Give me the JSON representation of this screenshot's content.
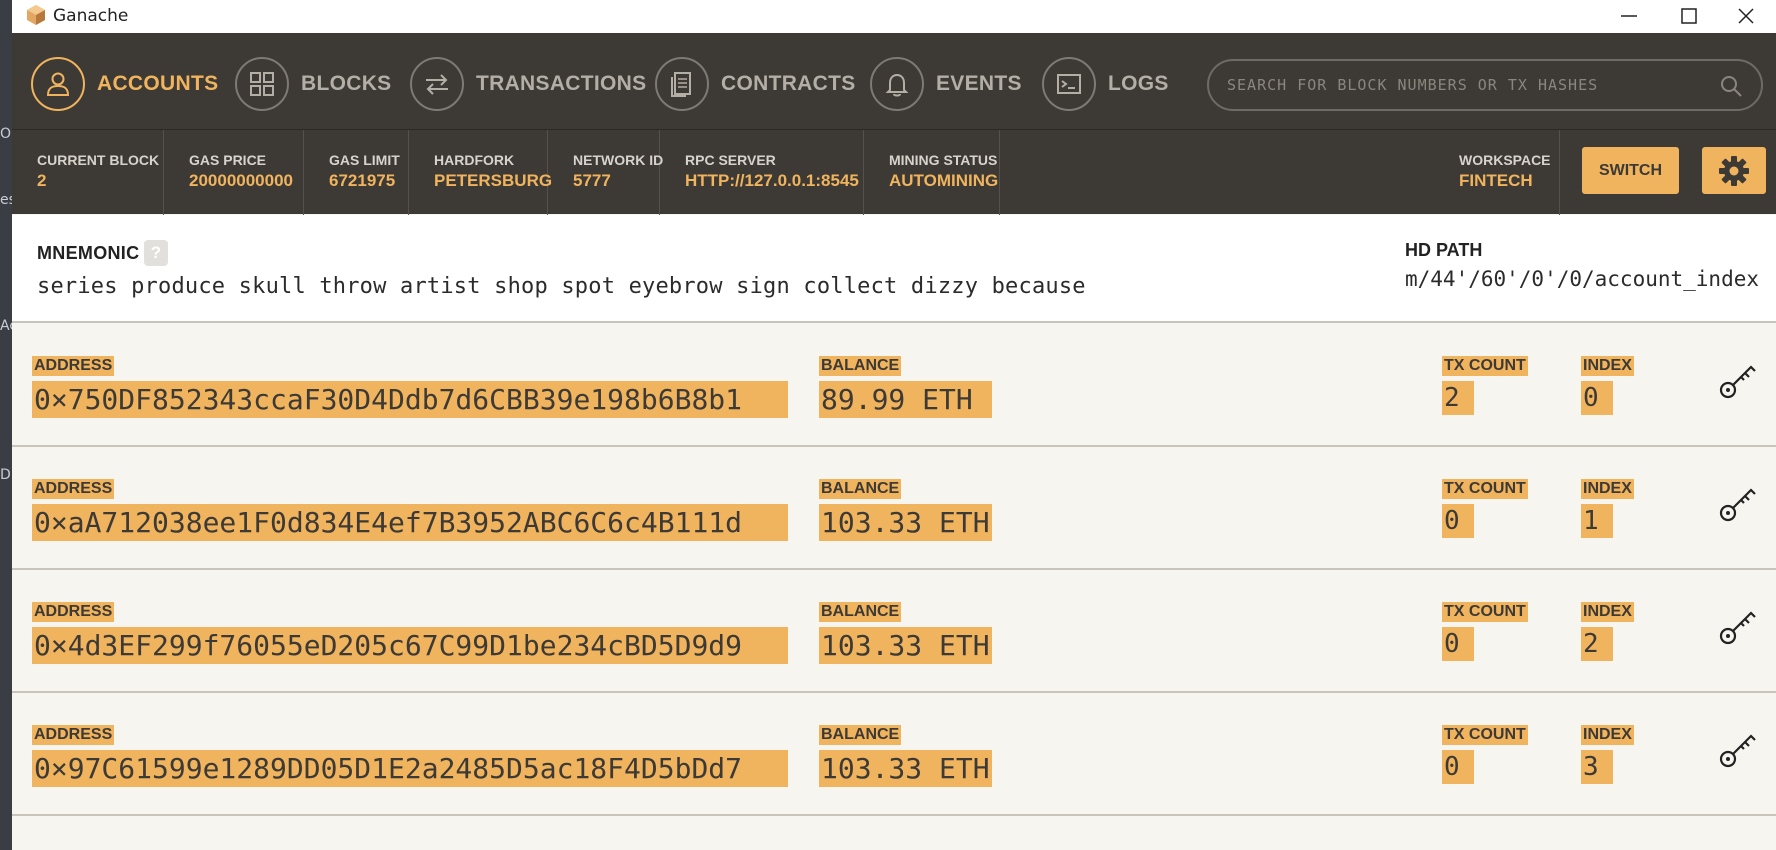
{
  "background": {
    "strip_text": [
      "O",
      "es",
      "Ac",
      "DB"
    ]
  },
  "window": {
    "title": "Ganache"
  },
  "nav": {
    "items": [
      {
        "label": "ACCOUNTS",
        "icon": "person-icon",
        "active": true
      },
      {
        "label": "BLOCKS",
        "icon": "grid-icon",
        "active": false
      },
      {
        "label": "TRANSACTIONS",
        "icon": "arrows-icon",
        "active": false
      },
      {
        "label": "CONTRACTS",
        "icon": "document-icon",
        "active": false
      },
      {
        "label": "EVENTS",
        "icon": "bell-icon",
        "active": false
      },
      {
        "label": "LOGS",
        "icon": "terminal-icon",
        "active": false
      }
    ],
    "search_placeholder": "SEARCH FOR BLOCK NUMBERS OR TX HASHES"
  },
  "stats": {
    "current_block": {
      "label": "CURRENT BLOCK",
      "value": "2"
    },
    "gas_price": {
      "label": "GAS PRICE",
      "value": "20000000000"
    },
    "gas_limit": {
      "label": "GAS LIMIT",
      "value": "6721975"
    },
    "hardfork": {
      "label": "HARDFORK",
      "value": "PETERSBURG"
    },
    "network_id": {
      "label": "NETWORK ID",
      "value": "5777"
    },
    "rpc_server": {
      "label": "RPC SERVER",
      "value": "HTTP://127.0.0.1:8545"
    },
    "mining_status": {
      "label": "MINING STATUS",
      "value": "AUTOMINING"
    },
    "workspace": {
      "label": "WORKSPACE",
      "value": "FINTECH"
    },
    "switch_label": "SWITCH"
  },
  "mnemonic": {
    "title": "MNEMONIC",
    "help": "?",
    "words": "series produce skull throw artist shop spot eyebrow sign collect dizzy because",
    "hd_path_title": "HD PATH",
    "hd_path": "m/44'/60'/0'/0/account_index"
  },
  "labels": {
    "address": "ADDRESS",
    "balance": "BALANCE",
    "tx_count": "TX COUNT",
    "index": "INDEX"
  },
  "accounts": [
    {
      "address": "0×750DF852343ccaF30D4Ddb7d6CBB39e198b6B8b1",
      "balance": "89.99 ETH ",
      "tx_count": "2",
      "index": "0"
    },
    {
      "address": "0×aA712038ee1F0d834E4ef7B3952ABC6C6c4B111d",
      "balance": "103.33 ETH",
      "tx_count": "0",
      "index": "1"
    },
    {
      "address": "0×4d3EF299f76055eD205c67C99D1be234cBD5D9d9",
      "balance": "103.33 ETH",
      "tx_count": "0",
      "index": "2"
    },
    {
      "address": "0×97C61599e1289DD05D1E2a2485D5ac18F4D5bDd7",
      "balance": "103.33 ETH",
      "tx_count": "0",
      "index": "3"
    }
  ],
  "colors": {
    "accent": "#f0b35e",
    "nav_bg": "#3d3a36",
    "row_bg": "#f7f5ef"
  }
}
